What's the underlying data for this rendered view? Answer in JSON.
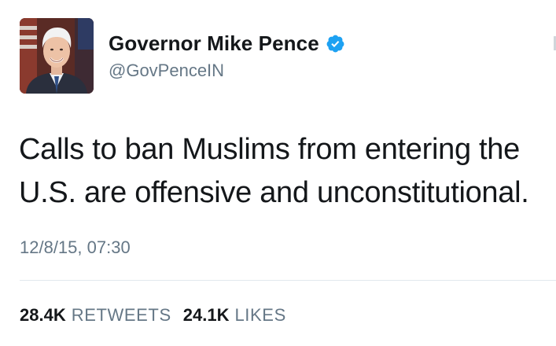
{
  "user": {
    "display_name": "Governor Mike Pence",
    "handle": "@GovPenceIN",
    "verified": true
  },
  "tweet": {
    "text_line_1": "Calls to ban Muslims from entering the",
    "text_line_2": "U.S. are offensive and unconstitutional.",
    "timestamp": "12/8/15, 07:30"
  },
  "stats": {
    "retweets_count": "28.4K",
    "retweets_label": "RETWEETS",
    "likes_count": "24.1K",
    "likes_label": "LIKES"
  },
  "icons": {
    "verified_badge": "verified-badge-icon"
  },
  "colors": {
    "text": "#14171a",
    "secondary": "#657786",
    "verified": "#1da1f2",
    "divider": "#e1e8ed"
  }
}
